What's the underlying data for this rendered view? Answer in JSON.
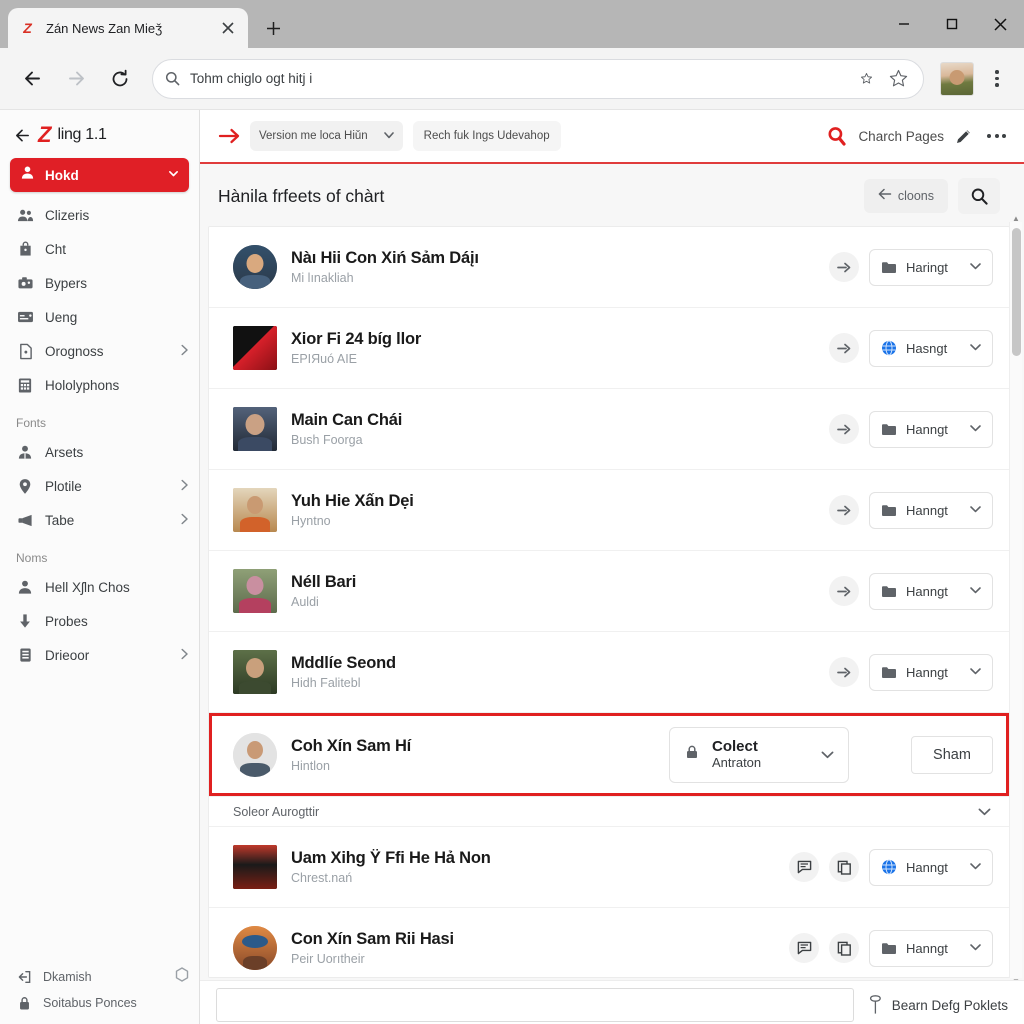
{
  "browser": {
    "tab": {
      "title": "Zán News Zan Mieǯ",
      "favicon": "Z",
      "close_icon": "close-icon"
    },
    "newtab_label": "+",
    "window_controls": {
      "minimize": "minimize-icon",
      "maximize": "maximize-icon",
      "close": "close-icon"
    },
    "nav": {
      "back_icon": "back-arrow-icon",
      "forward_icon": "forward-arrow-icon",
      "reload_icon": "reload-icon",
      "omnibox_value": "Tohm chiglo ogt hitj i",
      "omnibox_search_icon": "search-icon",
      "star_small_icon": "star-small-icon",
      "star_large_icon": "star-large-icon",
      "profile_icon": "profile-avatar",
      "menu_icon": "kebab-menu-icon"
    }
  },
  "sidebar": {
    "back_icon": "back-arrow-icon",
    "logo_mark": "Z",
    "brand": "ling 1.1",
    "active_item": {
      "label": "Hokd",
      "icon": "person-icon",
      "caret": "chevron-down-icon"
    },
    "items": [
      {
        "label": "Clizeris",
        "icon": "people-icon",
        "chevron": false
      },
      {
        "label": "Cht",
        "icon": "bag-icon",
        "chevron": false
      },
      {
        "label": "Bypers",
        "icon": "camera-icon",
        "chevron": false
      },
      {
        "label": "Ueng",
        "icon": "card-icon",
        "chevron": false
      },
      {
        "label": "Orognoss",
        "icon": "document-icon",
        "chevron": true
      },
      {
        "label": "Hololyphons",
        "icon": "grid-icon",
        "chevron": false
      }
    ],
    "section_fonts": "Fonts",
    "items_fonts": [
      {
        "label": "Arsets",
        "icon": "person-outline-icon",
        "chevron": false
      },
      {
        "label": "Plotile",
        "icon": "pin-icon",
        "chevron": true
      },
      {
        "label": "Tabe",
        "icon": "megaphone-icon",
        "chevron": true
      }
    ],
    "section_noms": "Noms",
    "items_noms": [
      {
        "label": "Hell Xʃln Chos",
        "icon": "person-icon",
        "chevron": false
      },
      {
        "label": "Probes",
        "icon": "download-icon",
        "chevron": false
      },
      {
        "label": "Drieoor",
        "icon": "server-icon",
        "chevron": true
      }
    ],
    "footer": [
      {
        "label": "Dkamish",
        "icon": "logout-icon",
        "trailing_icon": "hexagon-icon"
      },
      {
        "label": "Soitabus Ponces",
        "icon": "lock-icon",
        "trailing_icon": ""
      }
    ]
  },
  "toolbar": {
    "arrow_icon": "arrow-right-icon",
    "select_label": "Version me loca Hiǔn",
    "select_caret": "chevron-down-icon",
    "button_label": "Rech fuk Ings Udevahop",
    "search_icon": "search-icon-red",
    "link_label": "Charch Pages",
    "pencil_icon": "pencil-icon",
    "more_icon": "more-dots-icon"
  },
  "section": {
    "title": "Hànila frfeets of chàrt",
    "back_button": {
      "label": "cloons",
      "icon": "arrow-left-icon"
    },
    "search_button_icon": "search-icon"
  },
  "rows": [
    {
      "title": "Nàı Hii Con Xiń Sảm Dáįı",
      "subtitle": "Mi lınakliah",
      "avatar": "circle",
      "avatar_colors": [
        "#2b3a4a",
        "#d9a97f",
        "#3c5a78"
      ],
      "actions": [
        "forward-circle-icon"
      ],
      "badge": {
        "label": "Haringt",
        "icon": "folder-icon",
        "icon_color": "#5f6368",
        "caret": "chevron-down-icon"
      }
    },
    {
      "title": "Xior Fi 24 bíg llor",
      "subtitle": "EPIЯuó AIE",
      "avatar": "square",
      "avatar_colors": [
        "#111111",
        "#d7202a",
        "#8a1015"
      ],
      "actions": [
        "forward-circle-icon"
      ],
      "badge": {
        "label": "Hasngt",
        "icon": "globe-icon",
        "icon_color": "#1a73e8",
        "caret": "chevron-down-icon"
      }
    },
    {
      "title": "Main Can Chái",
      "subtitle": "Bush Foorga",
      "avatar": "square",
      "avatar_colors": [
        "#3f4a5a",
        "#caa184",
        "#222a36"
      ],
      "actions": [
        "forward-circle-icon"
      ],
      "badge": {
        "label": "Hanngt",
        "icon": "folder-icon",
        "icon_color": "#5f6368",
        "caret": "chevron-down-icon"
      }
    },
    {
      "title": "Yuh Hie Xấn Dẹi",
      "subtitle": "Hyntno",
      "avatar": "square",
      "avatar_colors": [
        "#d8c5a8",
        "#d2622a",
        "#b8884f"
      ],
      "actions": [
        "forward-circle-icon"
      ],
      "badge": {
        "label": "Hanngt",
        "icon": "folder-icon",
        "icon_color": "#5f6368",
        "caret": "chevron-down-icon"
      }
    },
    {
      "title": "Néll Bari",
      "subtitle": "Auldi",
      "avatar": "square",
      "avatar_colors": [
        "#7d8f6a",
        "#c98fa0",
        "#b4405f"
      ],
      "actions": [
        "forward-circle-icon"
      ],
      "badge": {
        "label": "Hanngt",
        "icon": "folder-icon",
        "icon_color": "#5f6368",
        "caret": "chevron-down-icon"
      }
    },
    {
      "title": "Mddlíe Seond",
      "subtitle": "Hidh Falitebl",
      "avatar": "square",
      "avatar_colors": [
        "#4a5a3a",
        "#c9a07c",
        "#2d3a24"
      ],
      "actions": [
        "forward-circle-icon"
      ],
      "badge": {
        "label": "Hanngt",
        "icon": "folder-icon",
        "icon_color": "#5f6368",
        "caret": "chevron-down-icon"
      }
    }
  ],
  "highlighted_row": {
    "title": "Coh Xín Sam Hí",
    "subtitle": "Hintlon",
    "avatar": "circle",
    "avatar_colors": [
      "#dcdcdc",
      "#c99a76",
      "#4a5a6a"
    ],
    "combo": {
      "icon": "lock-icon",
      "primary": "Colect",
      "secondary": "Antraton",
      "caret": "chevron-down-icon"
    },
    "action_button": "Sham",
    "highlight_color": "#e02020"
  },
  "group_row": {
    "label": "Soleor Aurogttir",
    "caret": "chevron-down-icon"
  },
  "rows_bottom": [
    {
      "title": "Uam Xihg Ÿ Ffi He Hả Non",
      "subtitle": "Chrest.nań",
      "avatar": "square",
      "avatar_colors": [
        "#1a1a1a",
        "#c0392b",
        "#7a1f14"
      ],
      "actions": [
        "comment-icon",
        "copy-icon"
      ],
      "badge": {
        "label": "Hanngt",
        "icon": "globe-icon",
        "icon_color": "#1a73e8",
        "caret": "chevron-down-icon"
      }
    },
    {
      "title": "Con Xín Sam Rii Hasi",
      "subtitle": "Peir Uorıtheir",
      "avatar": "circle",
      "avatar_colors": [
        "#d4763a",
        "#2b5a8a",
        "#8a4a2a"
      ],
      "actions": [
        "comment-icon",
        "copy-icon"
      ],
      "badge": {
        "label": "Hanngt",
        "icon": "folder-icon",
        "icon_color": "#5f6368",
        "caret": "chevron-down-icon"
      }
    }
  ],
  "bottombar": {
    "composer_placeholder": "",
    "right_icon": "mic-icon",
    "right_label": "Bearn Defg Poklets"
  },
  "colors": {
    "brand_red": "#e02020",
    "accent_blue": "#1a73e8",
    "toolbar_divider": "#e03c3c"
  }
}
